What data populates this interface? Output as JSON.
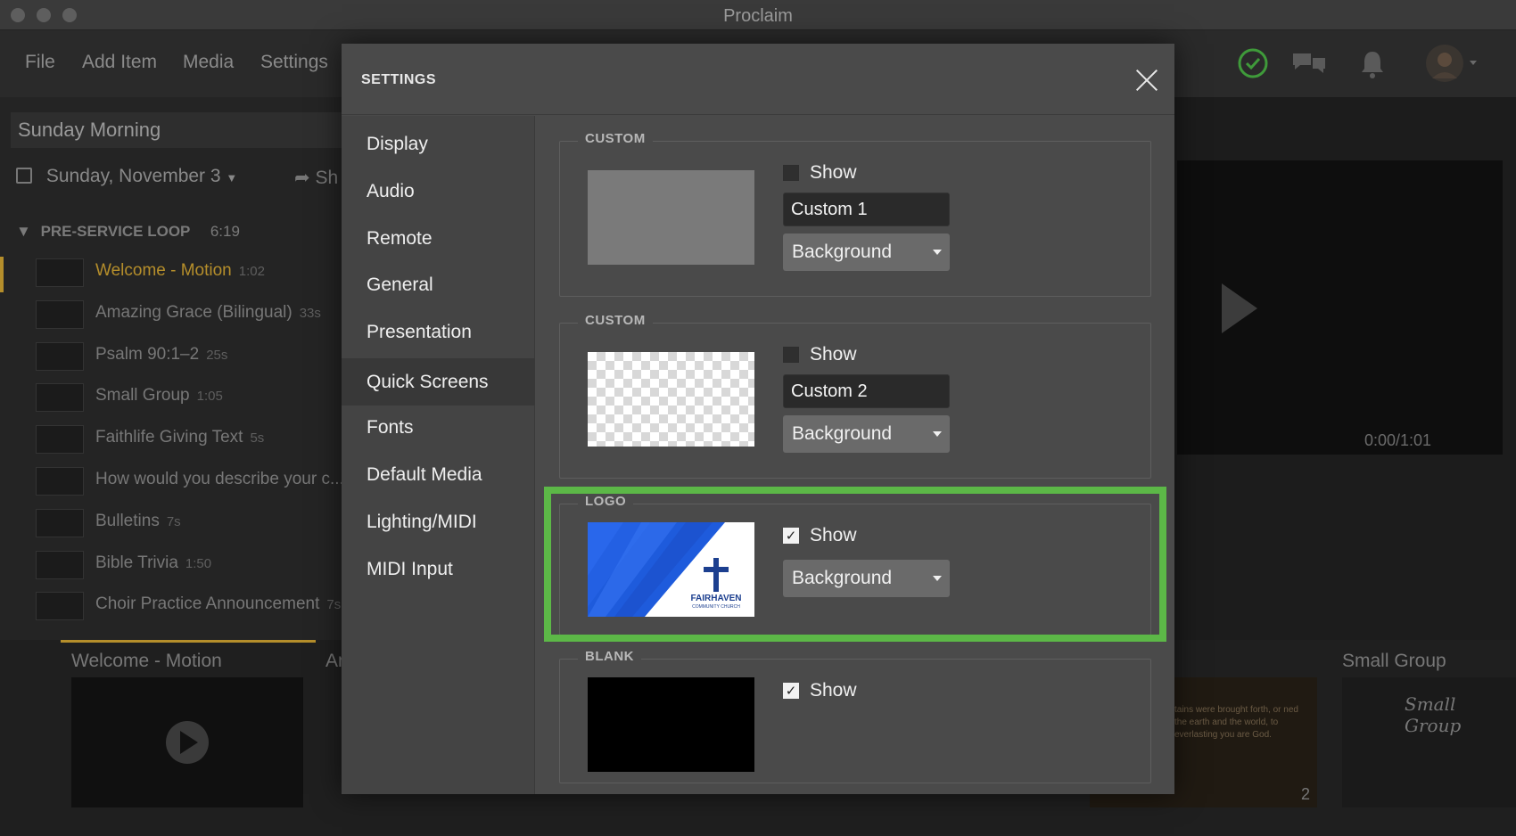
{
  "window": {
    "title": "Proclaim"
  },
  "menu": {
    "items": [
      "File",
      "Add Item",
      "Media",
      "Settings"
    ]
  },
  "service": {
    "name": "Sunday Morning",
    "date": "Sunday, November 3",
    "share_label": "Sh"
  },
  "preservice": {
    "title": "PRE-SERVICE LOOP",
    "duration": "6:19",
    "items": [
      {
        "label": "Welcome - Motion",
        "len": "1:02"
      },
      {
        "label": "Amazing Grace (Bilingual)",
        "len": "33s"
      },
      {
        "label": "Psalm 90:1–2",
        "len": "25s"
      },
      {
        "label": "Small Group",
        "len": "1:05"
      },
      {
        "label": "Faithlife Giving Text",
        "len": "5s"
      },
      {
        "label": "How would you describe your c...",
        "len": ""
      },
      {
        "label": "Bulletins",
        "len": "7s"
      },
      {
        "label": "Bible Trivia",
        "len": "1:50"
      },
      {
        "label": "Choir Practice Announcement",
        "len": "7s"
      }
    ]
  },
  "strip": {
    "titles": [
      "Welcome - Motion",
      "Ar",
      "Small Group"
    ],
    "small_group_card": "Small Group",
    "psalm_snippet": "tains were brought forth, or ned the earth and the world, to everlasting you are God."
  },
  "preview": {
    "time": "0:00/1:01"
  },
  "settings": {
    "title": "SETTINGS",
    "nav": [
      "Display",
      "Audio",
      "Remote",
      "General",
      "Presentation",
      "Quick Screens",
      "Fonts",
      "Default Media",
      "Lighting/MIDI",
      "MIDI Input"
    ],
    "selected_nav": "Quick Screens",
    "screens": [
      {
        "legend": "CUSTOM",
        "show_label": "Show",
        "show_checked": false,
        "name": "Custom 1",
        "select_value": "Background"
      },
      {
        "legend": "CUSTOM",
        "show_label": "Show",
        "show_checked": false,
        "name": "Custom 2",
        "select_value": "Background"
      },
      {
        "legend": "LOGO",
        "show_label": "Show",
        "show_checked": true,
        "select_value": "Background",
        "logo_name": "FAIRHAVEN",
        "logo_sub": "COMMUNITY CHURCH"
      },
      {
        "legend": "BLANK",
        "show_label": "Show",
        "show_checked": true
      }
    ]
  },
  "colors": {
    "highlight": "#5cb847",
    "active_item": "#b58e2b",
    "logo_blue": "#1e5bdc"
  }
}
